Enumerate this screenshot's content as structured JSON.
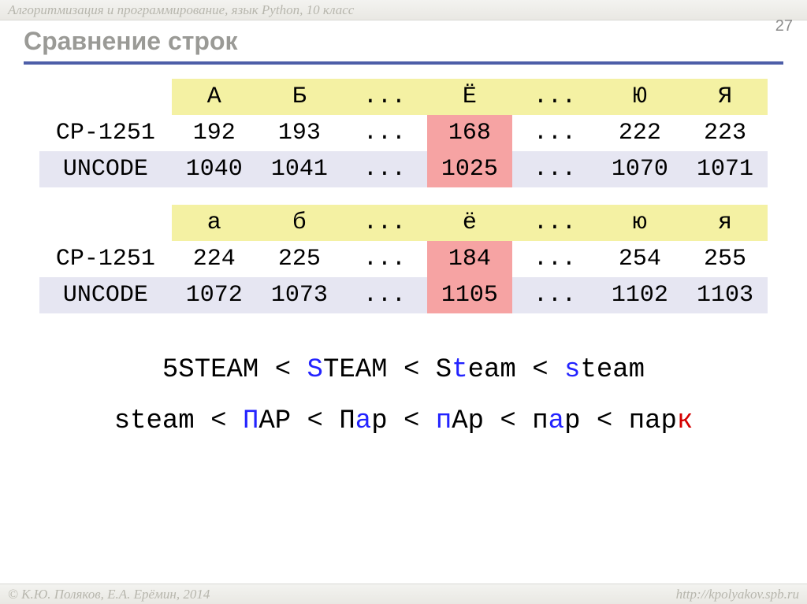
{
  "header": {
    "breadcrumb": "Алгоритмизация и программирование, язык Python, 10 класс",
    "page_number": "27",
    "title": "Сравнение строк"
  },
  "chart_data": [
    {
      "type": "table",
      "columns": [
        "",
        "А",
        "Б",
        "...",
        "Ё",
        "...",
        "Ю",
        "Я"
      ],
      "rows": [
        {
          "label": "CP-1251",
          "values": [
            "192",
            "193",
            "...",
            "168",
            "...",
            "222",
            "223"
          ],
          "highlight_index": 3
        },
        {
          "label": "UNCODE",
          "values": [
            "1040",
            "1041",
            "...",
            "1025",
            "...",
            "1070",
            "1071"
          ],
          "highlight_index": 3
        }
      ]
    },
    {
      "type": "table",
      "columns": [
        "",
        "а",
        "б",
        "...",
        "ё",
        "...",
        "ю",
        "я"
      ],
      "rows": [
        {
          "label": "CP-1251",
          "values": [
            "224",
            "225",
            "...",
            "184",
            "...",
            "254",
            "255"
          ],
          "highlight_index": 3
        },
        {
          "label": "UNCODE",
          "values": [
            "1072",
            "1073",
            "...",
            "1105",
            "...",
            "1102",
            "1103"
          ],
          "highlight_index": 3
        }
      ]
    }
  ],
  "examples": {
    "line1": [
      {
        "t": "5STEAM",
        "c": "blk"
      },
      {
        "t": " < ",
        "c": "blk"
      },
      {
        "t": "S",
        "c": "blue"
      },
      {
        "t": "TEAM",
        "c": "blk"
      },
      {
        "t": " < ",
        "c": "blk"
      },
      {
        "t": "S",
        "c": "blk"
      },
      {
        "t": "t",
        "c": "blue"
      },
      {
        "t": "eam",
        "c": "blk"
      },
      {
        "t": " < ",
        "c": "blk"
      },
      {
        "t": "s",
        "c": "blue"
      },
      {
        "t": "team",
        "c": "blk"
      }
    ],
    "line2": [
      {
        "t": "steam",
        "c": "blk"
      },
      {
        "t": " < ",
        "c": "blk"
      },
      {
        "t": "П",
        "c": "blue"
      },
      {
        "t": "АР",
        "c": "blk"
      },
      {
        "t": " < ",
        "c": "blk"
      },
      {
        "t": "П",
        "c": "blk"
      },
      {
        "t": "а",
        "c": "blue"
      },
      {
        "t": "р",
        "c": "blk"
      },
      {
        "t": " < ",
        "c": "blk"
      },
      {
        "t": "п",
        "c": "blue"
      },
      {
        "t": "Ар",
        "c": "blk"
      },
      {
        "t": " < ",
        "c": "blk"
      },
      {
        "t": "п",
        "c": "blk"
      },
      {
        "t": "а",
        "c": "blue"
      },
      {
        "t": "р",
        "c": "blk"
      },
      {
        "t": " < ",
        "c": "blk"
      },
      {
        "t": "пар",
        "c": "blk"
      },
      {
        "t": "к",
        "c": "red"
      }
    ]
  },
  "footer": {
    "copyright": "© К.Ю. Поляков, Е.А. Ерёмин, 2014",
    "url": "http://kpolyakov.spb.ru"
  }
}
